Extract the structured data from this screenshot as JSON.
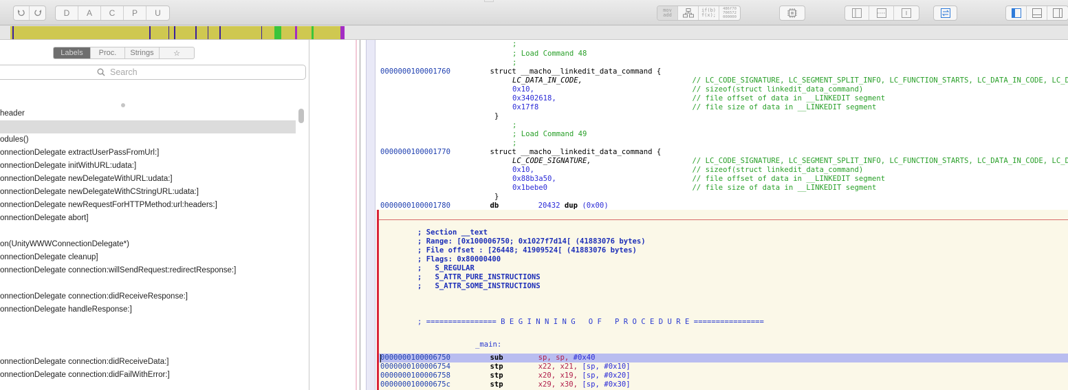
{
  "toolbar": {
    "undo_icon": "undo-icon",
    "redo_icon": "redo-icon",
    "type_buttons": [
      "D",
      "A",
      "C",
      "P",
      "U"
    ],
    "mode_buttons": [
      {
        "label": "mov\nadd",
        "name": "assembly-mode-button"
      },
      {
        "label": "",
        "name": "cfg-mode-button"
      },
      {
        "label": "if(b)\nf(x);",
        "name": "pseudocode-mode-button"
      },
      {
        "label": "486f70\n706572\n000000",
        "name": "hex-mode-button"
      }
    ],
    "icons": [
      "cpu-icon",
      "left-panel-icon",
      "middle-panel-icon",
      "right-panel-icon",
      "swap-icon",
      "sidebar-left-toggle-icon",
      "bottom-panel-toggle-icon",
      "sidebar-right-toggle-icon"
    ]
  },
  "navstrip": {
    "colors": {
      "code": "#cfc850",
      "procedure": "#3a1f9e",
      "data": "#3bc43b",
      "string": "#a32dc4",
      "background": "#e6e6e6"
    }
  },
  "sidebar": {
    "tabs": [
      "Labels",
      "Proc.",
      "Strings",
      "☆"
    ],
    "selected_tab": "Labels",
    "search_placeholder": "Search",
    "rows": [
      "header",
      "",
      "odules()",
      "onnectionDelegate extractUserPassFromUrl:]",
      "onnectionDelegate initWithURL:udata:]",
      "onnectionDelegate newDelegateWithURL:udata:]",
      "onnectionDelegate newDelegateWithCStringURL:udata:]",
      "onnectionDelegate newRequestForHTTPMethod:url:headers:]",
      "onnectionDelegate abort]",
      "",
      "on(UnityWWWConnectionDelegate*)",
      "onnectionDelegate cleanup]",
      "onnectionDelegate connection:willSendRequest:redirectResponse:]",
      "",
      "onnectionDelegate connection:didReceiveResponse:]",
      "onnectionDelegate handleResponse:]",
      "",
      "",
      "",
      "onnectionDelegate connection:didReceiveData:]",
      "onnectionDelegate connection:didFailWithError:]"
    ]
  },
  "code": {
    "lines": [
      [
        {
          "t": ";",
          "c": "cm"
        }
      ],
      [
        {
          "t": "; Load Command 48",
          "c": "cm"
        }
      ],
      [
        {
          "t": ";",
          "c": "cm"
        }
      ],
      [
        {
          "t": "0000000100001760",
          "c": "addr"
        },
        {
          "t": "         "
        },
        {
          "t": "struct __macho__linkedit_data_command {",
          "c": "kw-plain"
        }
      ],
      [
        {
          "t": "LC_DATA_IN_CODE,",
          "c": "it"
        },
        {
          "t": "                         "
        },
        {
          "t": "// LC_CODE_SIGNATURE, LC_SEGMENT_SPLIT_INFO, LC_FUNCTION_STARTS, LC_DATA_IN_CODE, LC_DYLIB_CODE_SIGN_DRS",
          "c": "cm"
        }
      ],
      [
        {
          "t": "0x10,",
          "c": "op"
        },
        {
          "t": "                                    "
        },
        {
          "t": "// sizeof(struct linkedit_data_command)",
          "c": "cm"
        }
      ],
      [
        {
          "t": "0x3402618,",
          "c": "op"
        },
        {
          "t": "                               "
        },
        {
          "t": "// file offset of data in __LINKEDIT segment",
          "c": "cm"
        }
      ],
      [
        {
          "t": "0x17f8",
          "c": "op"
        },
        {
          "t": "                                   "
        },
        {
          "t": "// file size of data in __LINKEDIT segment",
          "c": "cm"
        }
      ],
      [
        {
          "t": "}",
          "c": "plain"
        }
      ],
      [
        {
          "t": ";",
          "c": "cm"
        }
      ],
      [
        {
          "t": "; Load Command 49",
          "c": "cm"
        }
      ],
      [
        {
          "t": ";",
          "c": "cm"
        }
      ],
      [
        {
          "t": "0000000100001770",
          "c": "addr"
        },
        {
          "t": "         "
        },
        {
          "t": "struct __macho__linkedit_data_command {",
          "c": "kw-plain"
        }
      ],
      [
        {
          "t": "LC_CODE_SIGNATURE,",
          "c": "it"
        },
        {
          "t": "                       "
        },
        {
          "t": "// LC_CODE_SIGNATURE, LC_SEGMENT_SPLIT_INFO, LC_FUNCTION_STARTS, LC_DATA_IN_CODE, LC_DYLIB_CODE_SIGN_DRS",
          "c": "cm"
        }
      ],
      [
        {
          "t": "0x10,",
          "c": "op"
        },
        {
          "t": "                                    "
        },
        {
          "t": "// sizeof(struct linkedit_data_command)",
          "c": "cm"
        }
      ],
      [
        {
          "t": "0x88b3a50,",
          "c": "op"
        },
        {
          "t": "                               "
        },
        {
          "t": "// file offset of data in __LINKEDIT segment",
          "c": "cm"
        }
      ],
      [
        {
          "t": "0x1bebe0",
          "c": "op"
        },
        {
          "t": "                                 "
        },
        {
          "t": "// file size of data in __LINKEDIT segment",
          "c": "cm"
        }
      ],
      [
        {
          "t": "}",
          "c": "plain"
        }
      ],
      [
        {
          "t": "0000000100001780",
          "c": "addr"
        },
        {
          "t": "         "
        },
        {
          "t": "db",
          "c": "kw"
        },
        {
          "t": "         "
        },
        {
          "t": "20432",
          "c": "op"
        },
        {
          "t": " dup",
          "c": "kw"
        },
        {
          "t": " (0x00)",
          "c": "op"
        }
      ],
      [
        {
          "t": "; Section __text",
          "c": "cmb"
        }
      ],
      [
        {
          "t": "; Range: [0x100006750; 0x1027f7d14[ (41883076 bytes)",
          "c": "cmb"
        }
      ],
      [
        {
          "t": "; File offset : [26448; 41909524[ (41883076 bytes)",
          "c": "cmb"
        }
      ],
      [
        {
          "t": "; Flags: 0x80000400",
          "c": "cmb"
        }
      ],
      [
        {
          "t": ";   S_REGULAR",
          "c": "cmb"
        }
      ],
      [
        {
          "t": ";   S_ATTR_PURE_INSTRUCTIONS",
          "c": "cmb"
        }
      ],
      [
        {
          "t": ";   S_ATTR_SOME_INSTRUCTIONS",
          "c": "cmb"
        }
      ],
      [
        {
          "t": "; ================ B E G I N N I N G   O F   P R O C E D U R E ================",
          "c": "lbl"
        }
      ],
      [
        {
          "t": "_main:",
          "c": "lbl"
        }
      ],
      [
        {
          "t": "0000000100006750",
          "c": "addr"
        },
        {
          "t": "         "
        },
        {
          "t": "sub",
          "c": "kw"
        },
        {
          "t": "        "
        },
        {
          "t": "sp, sp, ",
          "c": "opr"
        },
        {
          "t": "#0x40",
          "c": "op"
        }
      ],
      [
        {
          "t": "0000000100006754",
          "c": "addr"
        },
        {
          "t": "         "
        },
        {
          "t": "stp",
          "c": "kw"
        },
        {
          "t": "        "
        },
        {
          "t": "x22, x21, ",
          "c": "opr"
        },
        {
          "t": "[sp, #0x10]",
          "c": "op"
        }
      ],
      [
        {
          "t": "0000000100006758",
          "c": "addr"
        },
        {
          "t": "         "
        },
        {
          "t": "stp",
          "c": "kw"
        },
        {
          "t": "        "
        },
        {
          "t": "x20, x19, ",
          "c": "opr"
        },
        {
          "t": "[sp, #0x20]",
          "c": "op"
        }
      ],
      [
        {
          "t": "000000010000675c",
          "c": "addr"
        },
        {
          "t": "         "
        },
        {
          "t": "stp",
          "c": "kw"
        },
        {
          "t": "        "
        },
        {
          "t": "x29, x30, ",
          "c": "opr"
        },
        {
          "t": "[sp, #0x30]",
          "c": "op"
        }
      ]
    ]
  }
}
